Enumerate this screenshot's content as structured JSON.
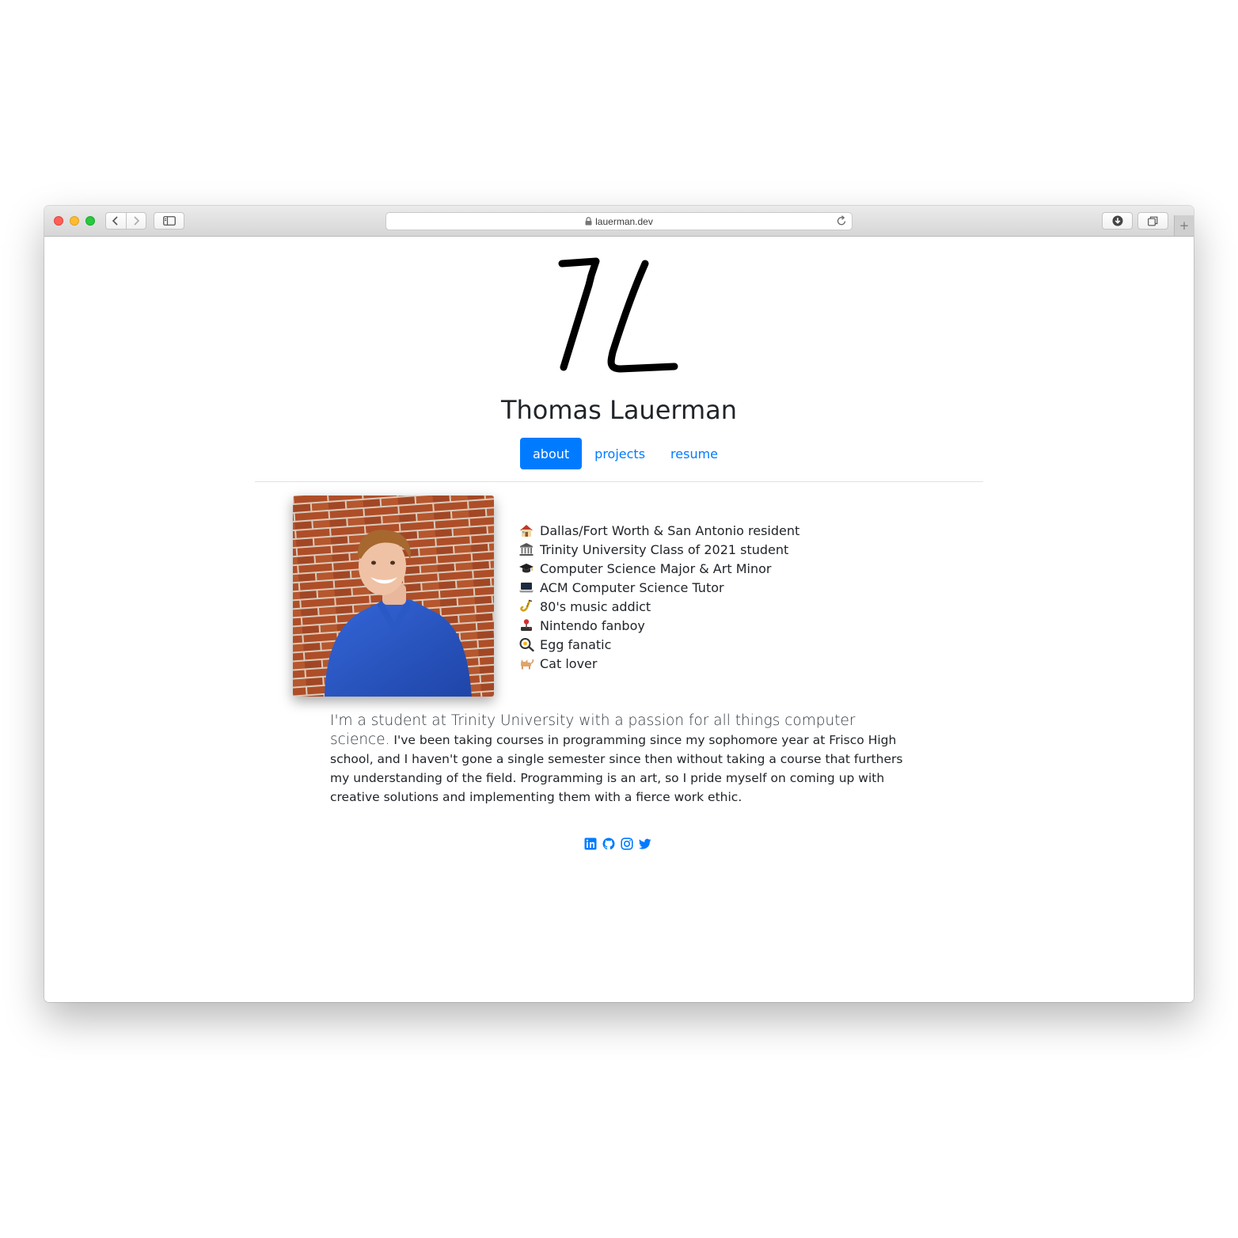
{
  "browser": {
    "url": "lauerman.dev",
    "icons": {
      "close": "close-light",
      "minimize": "minimize-light",
      "zoom": "zoom-light",
      "back": "chevron-left-icon",
      "forward": "chevron-right-icon",
      "sidebar": "sidebar-icon",
      "lock": "lock-icon",
      "reload": "reload-icon",
      "downloads": "download-icon",
      "tabs": "tab-overview-icon",
      "new_tab": "plus-icon"
    },
    "new_tab_label": "+"
  },
  "header": {
    "logo": "TL monogram logo",
    "name": "Thomas Lauerman"
  },
  "nav": {
    "tabs": [
      {
        "label": "about",
        "active": true
      },
      {
        "label": "projects",
        "active": false
      },
      {
        "label": "resume",
        "active": false
      }
    ]
  },
  "profile": {
    "photo": "portrait photo in front of brick wall",
    "facts": [
      {
        "icon": "house-icon",
        "text": "Dallas/Fort Worth & San Antonio resident"
      },
      {
        "icon": "classical-building-icon",
        "text": "Trinity University Class of 2021 student"
      },
      {
        "icon": "graduation-cap-icon",
        "text": "Computer Science Major & Art Minor"
      },
      {
        "icon": "laptop-icon",
        "text": "ACM Computer Science Tutor"
      },
      {
        "icon": "saxophone-icon",
        "text": "80's music addict"
      },
      {
        "icon": "joystick-icon",
        "text": "Nintendo fanboy"
      },
      {
        "icon": "fried-egg-icon",
        "text": "Egg fanatic"
      },
      {
        "icon": "cat-icon",
        "text": "Cat lover"
      }
    ]
  },
  "bio": {
    "lead": "I'm a student at Trinity University with a passion for all things computer science.",
    "body": " I've been taking courses in programming since my sophomore year at Frisco High school, and I haven't gone a single semester since then without taking a course that furthers my understanding of the field. Programming is an art, so I pride myself on coming up with creative solutions and implementing them with a fierce work ethic."
  },
  "social": [
    "linkedin-icon",
    "github-icon",
    "instagram-icon",
    "twitter-icon"
  ],
  "colors": {
    "accent": "#007bff",
    "text": "#212529",
    "brick": "#b4532f",
    "shirt": "#2a55c8"
  }
}
